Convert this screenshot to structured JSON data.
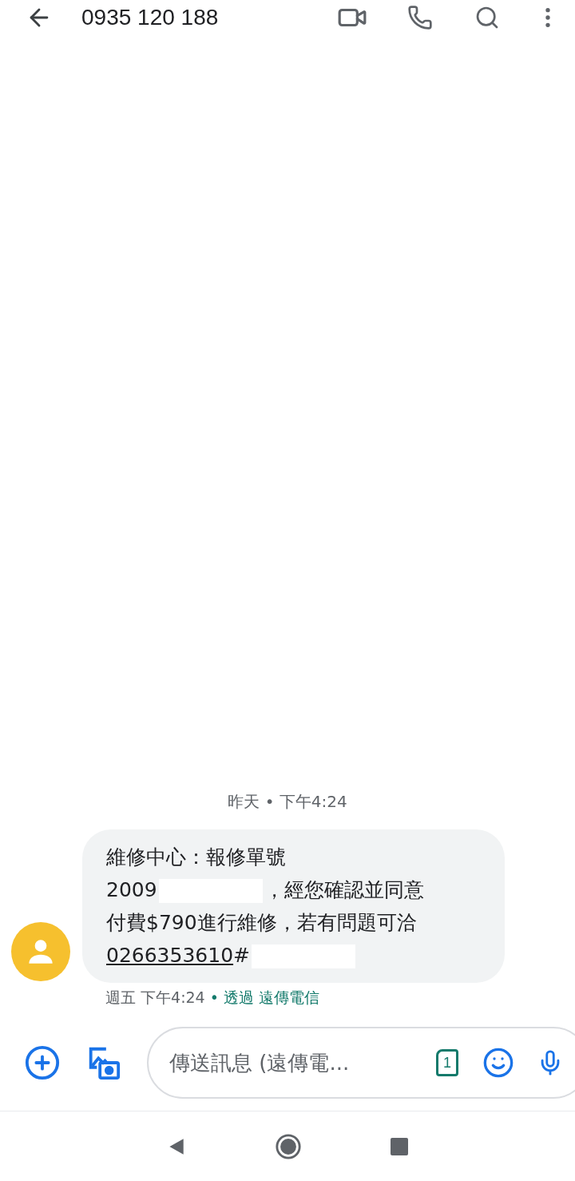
{
  "header": {
    "title": "0935 120 188"
  },
  "conversation": {
    "date_divider": "昨天 • 下午4:24",
    "message": {
      "lines": [
        [
          {
            "kind": "text",
            "text": "維修中心：報修單號"
          }
        ],
        [
          {
            "kind": "text",
            "text": "2009"
          },
          {
            "kind": "redaction"
          },
          {
            "kind": "text",
            "text": "，經您確認並同意"
          }
        ],
        [
          {
            "kind": "text",
            "text": "付費$790進行維修，若有問題可洽"
          }
        ],
        [
          {
            "kind": "link",
            "text": "0266353610"
          },
          {
            "kind": "text",
            "text": "#"
          },
          {
            "kind": "redaction"
          }
        ]
      ],
      "time": "週五 下午4:24",
      "via": "• 透過 遠傳電信"
    }
  },
  "composer": {
    "placeholder": "傳送訊息 (遠傳電...",
    "sim": "1"
  }
}
